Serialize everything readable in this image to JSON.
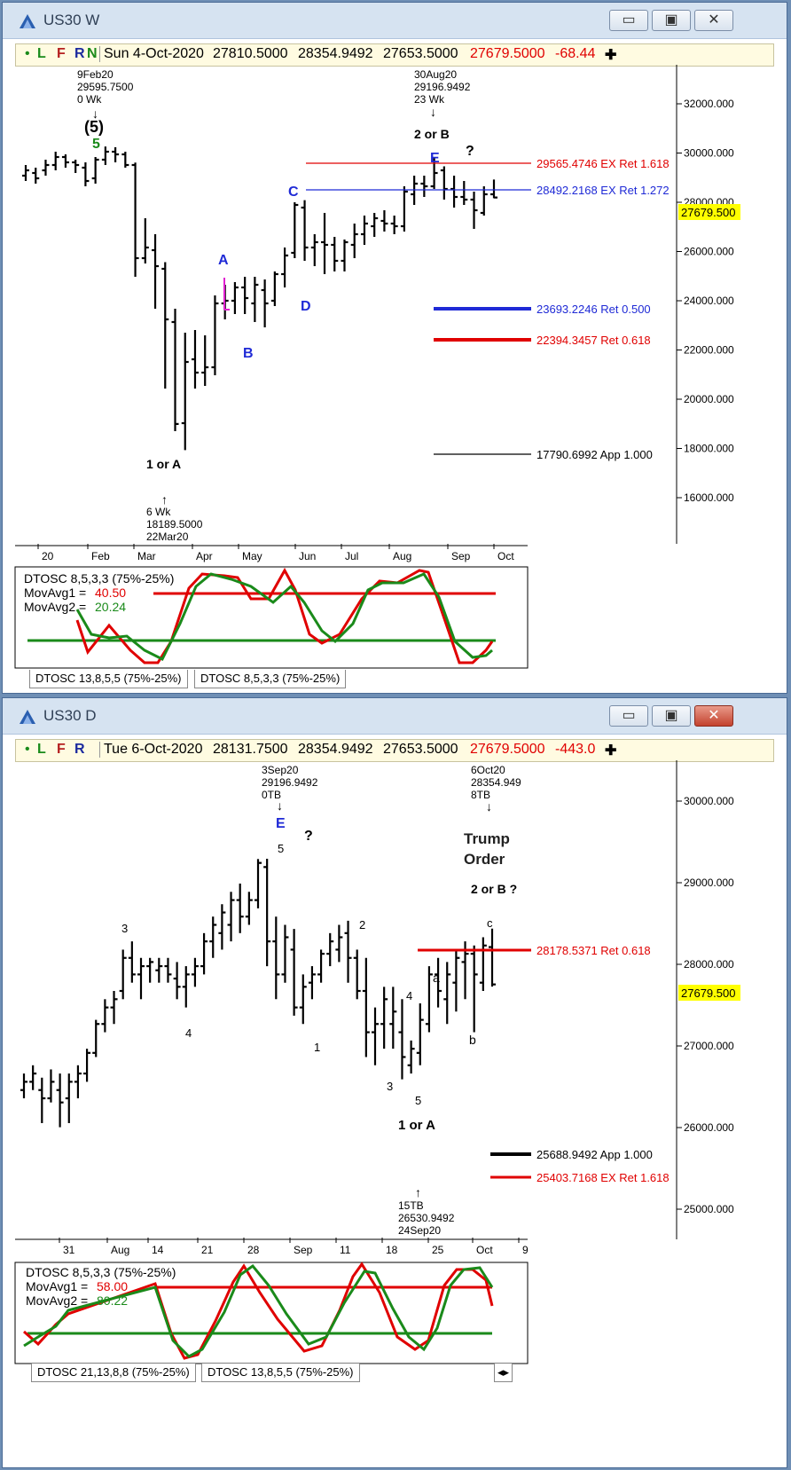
{
  "windows": {
    "weekly": {
      "title": "US30 W",
      "toolbar": {
        "dot": "•",
        "L": "L",
        "F": "F",
        "R": "R",
        "N": "N",
        "date": "Sun 4-Oct-2020",
        "open": "27810.5000",
        "high": "28354.9492",
        "low": "27653.5000",
        "close": "27679.5000",
        "change": "-68.44",
        "plus": "✚"
      },
      "price_labels": [
        "32000.000",
        "30000.000",
        "28000.000",
        "26000.000",
        "24000.000",
        "22000.000",
        "20000.000",
        "18000.000",
        "16000.000"
      ],
      "current_price": "27679.500",
      "x_labels": [
        "20",
        "Feb",
        "Mar",
        "Apr",
        "May",
        "Jun",
        "Jul",
        "Aug",
        "Sep",
        "Oct"
      ],
      "annotations": {
        "peak_info": [
          "9Feb20",
          "29595.7500",
          "0 Wk"
        ],
        "wave5_paren": "(5)",
        "wave5": "5",
        "top_info": [
          "30Aug20",
          "29196.9492",
          "23 Wk"
        ],
        "two_or_b": "2 or B",
        "E": "E",
        "q": "?",
        "C": "C",
        "A": "A",
        "B": "B",
        "D": "D",
        "one_or_a": "1 or A",
        "low_info": [
          "6 Wk",
          "18189.5000",
          "22Mar20"
        ]
      },
      "levels": [
        {
          "text": "29565.4746 EX Ret 1.618",
          "color": "#e00000"
        },
        {
          "text": "28492.2168 EX Ret 1.272",
          "color": "#1f2ad6"
        },
        {
          "text": "23693.2246 Ret 0.500",
          "color": "#1f2ad6"
        },
        {
          "text": "22394.3457 Ret 0.618",
          "color": "#e00000"
        },
        {
          "text": "17790.6992 App 1.000",
          "color": "#000000"
        }
      ],
      "oscillator": {
        "name": "DTOSC 8,5,3,3 (75%-25%)",
        "ma1_label": "MovAvg1 =",
        "ma1_value": "40.50",
        "ma2_label": "MovAvg2 =",
        "ma2_value": "20.24"
      },
      "tabs": [
        "DTOSC 13,8,5,5 (75%-25%)",
        "DTOSC 8,5,3,3 (75%-25%)"
      ]
    },
    "daily": {
      "title": "US30 D",
      "toolbar": {
        "dot": "•",
        "L": "L",
        "F": "F",
        "R": "R",
        "date": "Tue 6-Oct-2020",
        "open": "28131.7500",
        "high": "28354.9492",
        "low": "27653.5000",
        "close": "27679.5000",
        "change": "-443.0",
        "plus": "✚"
      },
      "price_labels": [
        "30000.000",
        "29000.000",
        "28000.000",
        "27000.000",
        "26000.000",
        "25000.000"
      ],
      "current_price": "27679.500",
      "x_labels": [
        "31",
        "Aug",
        "14",
        "21",
        "28",
        "Sep",
        "11",
        "18",
        "25",
        "Oct",
        "9"
      ],
      "annotations": {
        "top_info": [
          "3Sep20",
          "29196.9492",
          "0TB"
        ],
        "E": "E",
        "q": "?",
        "five_top": "5",
        "right_info": [
          "6Oct20",
          "28354.949",
          "8TB"
        ],
        "trump": "Trump",
        "order": "Order",
        "two_or_b": "2 or B ?",
        "c": "c",
        "w3a": "3",
        "w4a": "4",
        "w1": "1",
        "w2": "2",
        "w3b": "3",
        "w4b": "4",
        "w5b": "5",
        "a": "a",
        "b": "b",
        "one_or_a": "1 or A",
        "low_info": [
          "15TB",
          "26530.9492",
          "24Sep20"
        ]
      },
      "levels": [
        {
          "text": "28178.5371 Ret 0.618",
          "color": "#e00000"
        },
        {
          "text": "25688.9492 App 1.000",
          "color": "#000000"
        },
        {
          "text": "25403.7168 EX Ret 1.618",
          "color": "#e00000"
        }
      ],
      "oscillator": {
        "name": "DTOSC 8,5,3,3 (75%-25%)",
        "ma1_label": "MovAvg1 =",
        "ma1_value": "58.00",
        "ma2_label": "MovAvg2 =",
        "ma2_value": "80.22"
      },
      "tabs": [
        "DTOSC 21,13,8,8 (75%-25%)",
        "DTOSC 13,8,5,5 (75%-25%)"
      ]
    }
  },
  "chart_data": [
    {
      "type": "ohlc",
      "title": "US30 W",
      "ylim": [
        15000,
        33000
      ],
      "bars": [
        [
          28500,
          28900,
          28300,
          28700
        ],
        [
          28600,
          28800,
          28200,
          28400
        ],
        [
          28700,
          29100,
          28500,
          28900
        ],
        [
          28900,
          29400,
          28700,
          29200
        ],
        [
          29200,
          29300,
          28800,
          29000
        ],
        [
          29000,
          29100,
          28600,
          28900
        ],
        [
          28800,
          29000,
          28100,
          28300
        ],
        [
          28400,
          29200,
          28200,
          29100
        ],
        [
          29100,
          29595,
          28900,
          29400
        ],
        [
          29400,
          29568,
          29000,
          29300
        ],
        [
          29300,
          29400,
          28800,
          28900
        ],
        [
          28900,
          28990,
          24700,
          25400
        ],
        [
          25400,
          26900,
          25200,
          25800
        ],
        [
          25700,
          26300,
          23500,
          25100
        ],
        [
          25000,
          25250,
          20500,
          23100
        ],
        [
          23000,
          23500,
          18900,
          19170
        ],
        [
          19200,
          22600,
          18189,
          21500
        ],
        [
          21600,
          22700,
          20500,
          21100
        ],
        [
          21100,
          22500,
          20600,
          21300
        ],
        [
          21300,
          24000,
          21000,
          23700
        ],
        [
          23700,
          24400,
          23100,
          23800
        ],
        [
          23800,
          24500,
          23300,
          24300
        ],
        [
          24300,
          24700,
          23300,
          23900
        ],
        [
          23700,
          24700,
          23000,
          24400
        ],
        [
          24200,
          24600,
          22800,
          23700
        ],
        [
          23800,
          24900,
          23600,
          24800
        ],
        [
          24800,
          25800,
          24300,
          25500
        ],
        [
          25600,
          27500,
          25400,
          27400
        ],
        [
          27300,
          27580,
          25300,
          25800
        ],
        [
          25800,
          26300,
          25100,
          26000
        ],
        [
          26000,
          27100,
          24800,
          25900
        ],
        [
          25900,
          26200,
          24900,
          25300
        ],
        [
          25300,
          26100,
          24900,
          26000
        ],
        [
          25900,
          26700,
          25400,
          26300
        ],
        [
          26300,
          27000,
          25900,
          26700
        ],
        [
          26600,
          27100,
          26200,
          26900
        ],
        [
          26800,
          27200,
          26400,
          26700
        ],
        [
          26700,
          27000,
          26300,
          26600
        ],
        [
          26600,
          28100,
          26400,
          27900
        ],
        [
          27800,
          28500,
          27400,
          28200
        ],
        [
          28200,
          28500,
          27700,
          28100
        ],
        [
          28100,
          29197,
          28000,
          28600
        ],
        [
          28700,
          28850,
          27600,
          28000
        ],
        [
          28000,
          28500,
          27300,
          27700
        ],
        [
          27700,
          28300,
          27400,
          27600
        ],
        [
          27600,
          27900,
          26500,
          27200
        ],
        [
          27100,
          28100,
          27000,
          27800
        ],
        [
          27800,
          28354,
          27653,
          27679
        ]
      ],
      "oscillator": {
        "ylim": [
          0,
          100
        ],
        "ma1": 40.5,
        "ma2": 20.24
      }
    },
    {
      "type": "ohlc",
      "title": "US30 D",
      "ylim": [
        24700,
        30500
      ],
      "bars": [
        [
          26400,
          26600,
          26300,
          26500
        ],
        [
          26500,
          26700,
          26400,
          26600
        ],
        [
          26400,
          26550,
          26000,
          26300
        ],
        [
          26300,
          26650,
          26250,
          26500
        ],
        [
          26400,
          26600,
          25950,
          26250
        ],
        [
          26300,
          26600,
          26000,
          26500
        ],
        [
          26500,
          26700,
          26300,
          26600
        ],
        [
          26600,
          26900,
          26500,
          26850
        ],
        [
          26850,
          27250,
          26800,
          27200
        ],
        [
          27200,
          27500,
          27100,
          27400
        ],
        [
          27400,
          27600,
          27200,
          27500
        ],
        [
          27600,
          28100,
          27500,
          28000
        ],
        [
          28000,
          28200,
          27700,
          27800
        ],
        [
          27800,
          28000,
          27500,
          27900
        ],
        [
          27900,
          28000,
          27700,
          27950
        ],
        [
          27850,
          28000,
          27700,
          27900
        ],
        [
          27900,
          28000,
          27700,
          27800
        ],
        [
          27750,
          27950,
          27500,
          27650
        ],
        [
          27650,
          27900,
          27400,
          27800
        ],
        [
          27800,
          28000,
          27650,
          27900
        ],
        [
          27900,
          28300,
          27800,
          28200
        ],
        [
          28200,
          28500,
          28000,
          28400
        ],
        [
          28300,
          28650,
          28100,
          28550
        ],
        [
          28400,
          28800,
          28200,
          28700
        ],
        [
          28700,
          28900,
          28300,
          28500
        ],
        [
          28500,
          28800,
          28400,
          28700
        ],
        [
          28700,
          29197,
          28600,
          29150
        ],
        [
          29100,
          29200,
          27900,
          28200
        ],
        [
          28200,
          28500,
          27500,
          27800
        ],
        [
          27800,
          28400,
          27700,
          28250
        ],
        [
          28100,
          28350,
          27300,
          27400
        ],
        [
          27400,
          27800,
          27200,
          27650
        ],
        [
          27700,
          27900,
          27500,
          27800
        ],
        [
          27800,
          28100,
          27700,
          28050
        ],
        [
          28050,
          28300,
          27900,
          28200
        ],
        [
          28100,
          28400,
          27950,
          28250
        ],
        [
          28300,
          28450,
          27700,
          28000
        ],
        [
          28000,
          28100,
          27500,
          27600
        ],
        [
          27600,
          28000,
          26800,
          27100
        ],
        [
          27100,
          27400,
          26700,
          27200
        ],
        [
          27200,
          27650,
          26900,
          27500
        ],
        [
          27200,
          27650,
          26900,
          27350
        ],
        [
          27100,
          27500,
          26530,
          26800
        ],
        [
          26700,
          27000,
          26600,
          26900
        ],
        [
          26850,
          27450,
          26700,
          27250
        ],
        [
          27200,
          27900,
          27100,
          27800
        ],
        [
          27800,
          28000,
          27400,
          27600
        ],
        [
          27500,
          27950,
          27200,
          27800
        ],
        [
          27700,
          28100,
          27350,
          28000
        ],
        [
          27950,
          28200,
          27500,
          28050
        ],
        [
          28050,
          28150,
          27100,
          27800
        ],
        [
          27700,
          28250,
          27600,
          28150
        ],
        [
          28131,
          28354,
          27653,
          27679
        ]
      ],
      "oscillator": {
        "ylim": [
          0,
          100
        ],
        "ma1": 58.0,
        "ma2": 80.22
      }
    }
  ]
}
